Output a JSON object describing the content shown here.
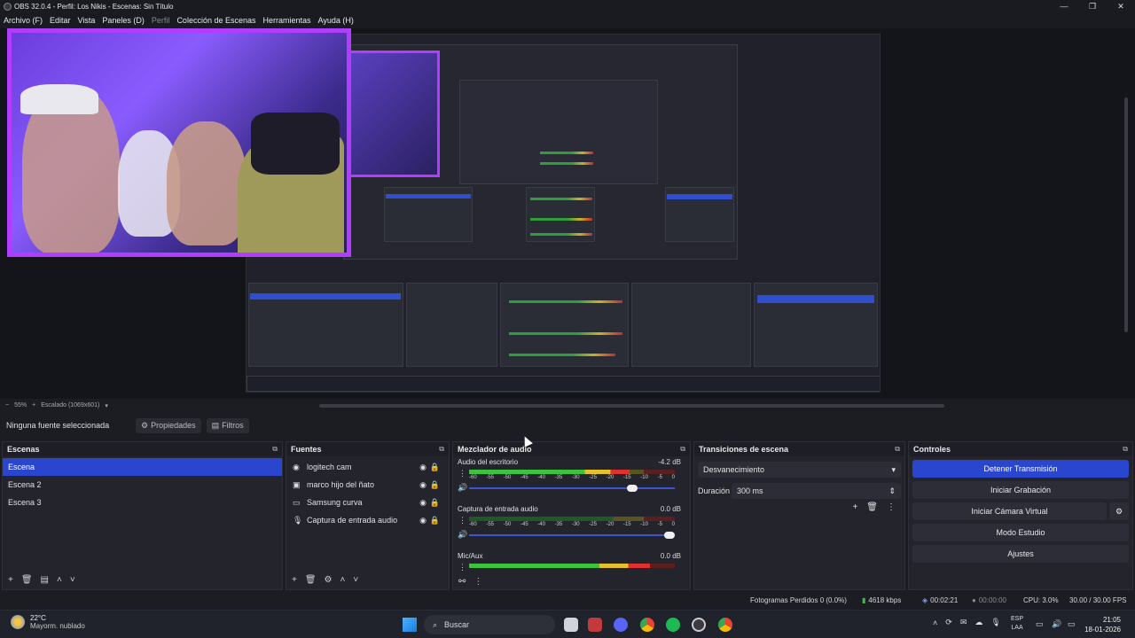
{
  "window": {
    "title": "OBS 32.0.4 - Perfil: Los Nikis - Escenas: Sin Título",
    "controls": [
      "—",
      "❐",
      "✕"
    ]
  },
  "menu": [
    {
      "label": "Archivo (F)",
      "dim": false
    },
    {
      "label": "Editar",
      "dim": false
    },
    {
      "label": "Vista",
      "dim": false
    },
    {
      "label": "Paneles (D)",
      "dim": false
    },
    {
      "label": "Perfil",
      "dim": true
    },
    {
      "label": "Colección de Escenas",
      "dim": false
    },
    {
      "label": "Herramientas",
      "dim": false
    },
    {
      "label": "Ayuda (H)",
      "dim": false
    }
  ],
  "preview": {
    "zoom": "55%",
    "scaling": "Escalado (1069x601)"
  },
  "source_toolbar": {
    "no_source": "Ninguna fuente seleccionada",
    "properties": "Propiedades",
    "filters": "Filtros"
  },
  "scenes": {
    "title": "Escenas",
    "items": [
      {
        "label": "Escena",
        "selected": true
      },
      {
        "label": "Escena 2",
        "selected": false
      },
      {
        "label": "Escena 3",
        "selected": false
      }
    ]
  },
  "sources": {
    "title": "Fuentes",
    "items": [
      {
        "label": "logitech cam",
        "icon": "camera-icon"
      },
      {
        "label": "marco hijo del ñato",
        "icon": "image-icon"
      },
      {
        "label": "Samsung curva",
        "icon": "monitor-icon"
      },
      {
        "label": "Captura de entrada audio",
        "icon": "microphone-icon"
      }
    ]
  },
  "mixer": {
    "title": "Mezclador de audio",
    "ticks": [
      "-60",
      "-55",
      "-50",
      "-45",
      "-40",
      "-35",
      "-30",
      "-25",
      "-20",
      "-15",
      "-10",
      "-5",
      "0"
    ],
    "channels": [
      {
        "name": "Audio del escritorio",
        "db": "-4.2 dB",
        "level": 0.78,
        "volume": 0.82
      },
      {
        "name": "Captura de entrada audio",
        "db": "0.0 dB",
        "level": 0.0,
        "volume": 1.0
      },
      {
        "name": "Mic/Aux",
        "db": "0.0 dB",
        "level": 0.88,
        "volume": 1.0
      }
    ]
  },
  "transitions": {
    "title": "Transiciones de escena",
    "selected": "Desvanecimiento",
    "duration_label": "Duración",
    "duration_value": "300 ms"
  },
  "controls": {
    "title": "Controles",
    "stop_stream": "Detener Transmisión",
    "start_record": "Iniciar Grabación",
    "virtual_cam": "Iniciar Cámara Virtual",
    "studio_mode": "Modo Estudio",
    "settings": "Ajustes"
  },
  "status": {
    "dropped": "Fotogramas Perdidos 0 (0.0%)",
    "bitrate": "4618 kbps",
    "stream_time": "00:02:21",
    "record_time": "00:00:00",
    "cpu": "CPU: 3.0%",
    "fps": "30.00 / 30.00 FPS"
  },
  "taskbar": {
    "weather_temp": "22°C",
    "weather_desc": "Mayorm. nublado",
    "search": "Buscar",
    "lang1": "ESP",
    "lang2": "LAA",
    "time": "21:05",
    "date": "18-01-2026"
  },
  "colors": {
    "accent": "#2a46cf",
    "frame": "#b23cff",
    "meter_green": "#39c43b",
    "meter_yellow": "#e3c02c",
    "meter_red": "#e03030"
  }
}
